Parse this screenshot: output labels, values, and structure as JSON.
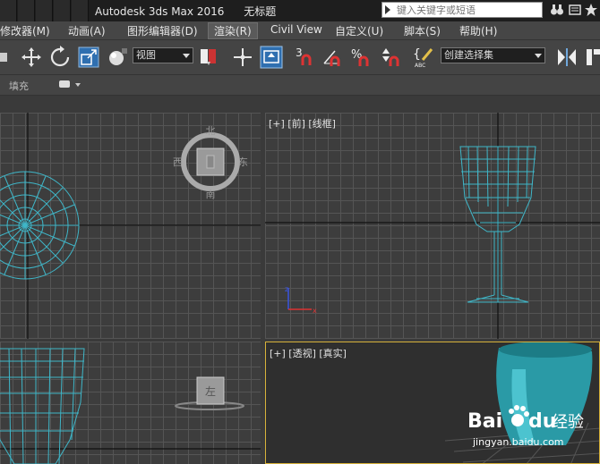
{
  "titlebar": {
    "app_title": "Autodesk 3ds Max 2016",
    "doc_title": "无标题",
    "search_placeholder": "键入关键字或短语"
  },
  "menubar": {
    "items": [
      {
        "label": "修改器(M)"
      },
      {
        "label": "动画(A)"
      },
      {
        "label": "图形编辑器(D)"
      },
      {
        "label": "渲染(R)"
      },
      {
        "label": "Civil View"
      },
      {
        "label": "自定义(U)"
      },
      {
        "label": "脚本(S)"
      },
      {
        "label": "帮助(H)"
      }
    ],
    "active_index": 3
  },
  "toolbar": {
    "reference_coord": "视图",
    "named_selection": "创建选择集",
    "snap_label": "3",
    "percent_label": "%",
    "abc_label": "ABC"
  },
  "ribbon": {
    "fill_label": "填充"
  },
  "viewports": {
    "top_left": {
      "compass": {
        "north": "北",
        "west": "西",
        "east": "东",
        "south": "南"
      }
    },
    "front": {
      "label": "[+] [前] [线框]"
    },
    "left": {
      "cube_label": "左"
    },
    "perspective": {
      "label": "[+] [透视] [真实]"
    }
  },
  "watermark": {
    "brand": "Bai",
    "brand2": "du",
    "site_cn": "经验",
    "url": "jingyan.baidu.com"
  },
  "colors": {
    "wire": "#3fb6c8",
    "highlight": "#d7b23a"
  }
}
